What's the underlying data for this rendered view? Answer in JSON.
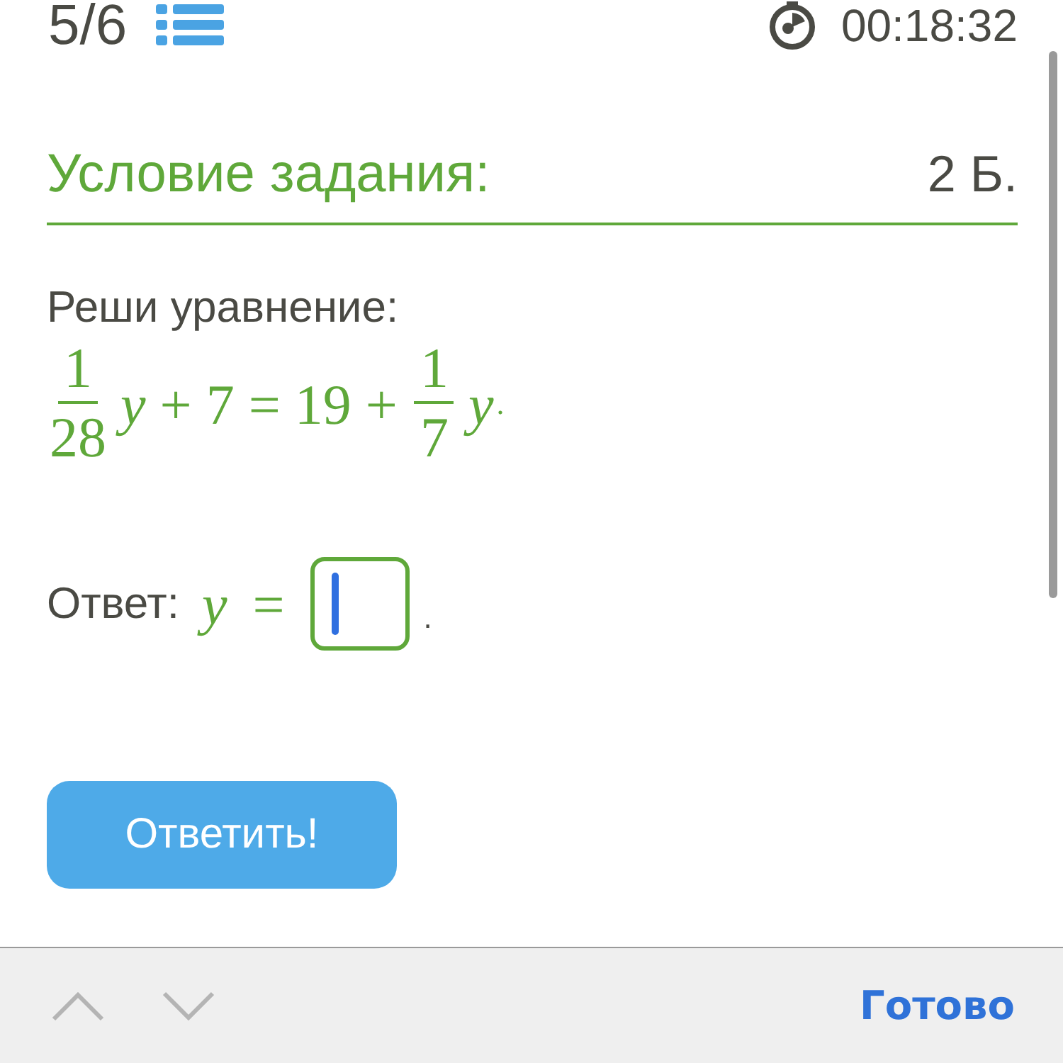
{
  "header": {
    "counter": "5/6",
    "timer": "00:18:32"
  },
  "task": {
    "title": "Условие задания:",
    "points": "2 Б.",
    "prompt": "Реши уравнение:",
    "equation": [
      {
        "kind": "frac",
        "num": "1",
        "den": "28"
      },
      {
        "kind": "var",
        "text": "y"
      },
      {
        "kind": "op",
        "text": "+"
      },
      {
        "kind": "num",
        "text": "7"
      },
      {
        "kind": "op",
        "text": "="
      },
      {
        "kind": "num",
        "text": "19"
      },
      {
        "kind": "op",
        "text": "+"
      },
      {
        "kind": "frac",
        "num": "1",
        "den": "7"
      },
      {
        "kind": "var",
        "text": "y"
      },
      {
        "kind": "punct",
        "text": "."
      }
    ]
  },
  "answer": {
    "label": "Ответ:",
    "variable": "y",
    "equals": "=",
    "focused": true,
    "end": "."
  },
  "submit": "Ответить!",
  "toolbar": {
    "done": "Готово"
  }
}
